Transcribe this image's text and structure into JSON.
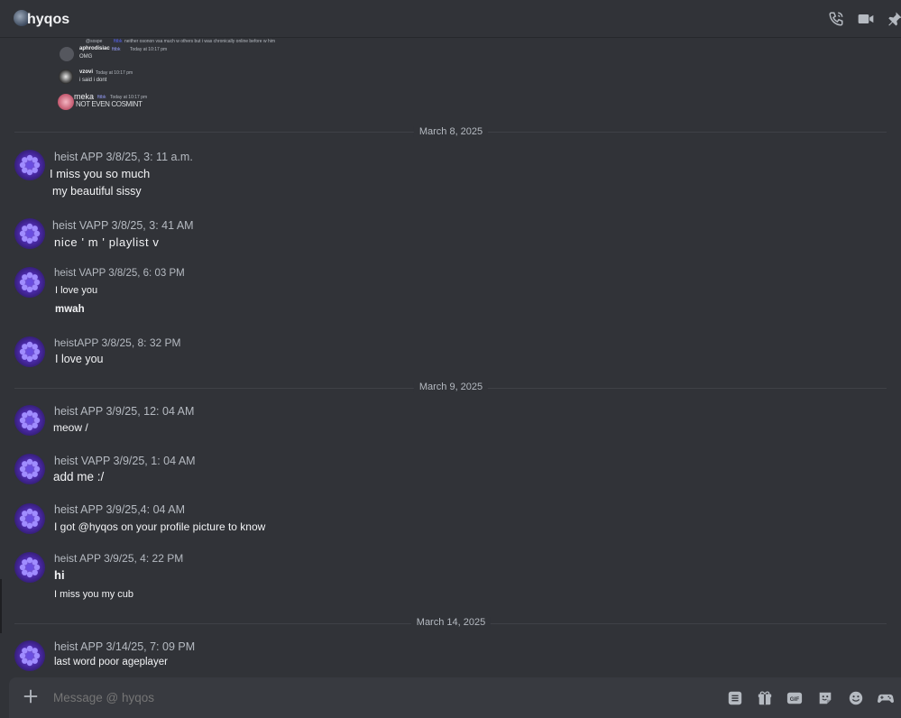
{
  "header": {
    "title": "hyqos"
  },
  "old_messages": [
    {
      "reply_user": "@sospe",
      "reply_tag": "fttbk",
      "reply_text": "neither osonon vsa much w others but i was chronically online before w him",
      "user": "aphrodisiac",
      "tag": "fttbk",
      "time": "Today at 10:17 pm",
      "text": "OMG"
    },
    {
      "user": "vzovi",
      "time": "Today at 10:17 pm",
      "text": "i said i dont"
    },
    {
      "user": "meka",
      "tag": "fttbk",
      "time": "Today at 10:17 pm",
      "text": "NOT EVEN COSMINT"
    }
  ],
  "dividers": {
    "d1": "March 8, 2025",
    "d2": "March 9, 2025",
    "d3": "March 14, 2025"
  },
  "messages": [
    {
      "meta": "heist APP 3/8/25, 3: 11 a.m.",
      "lines": [
        "I miss you so much",
        "my beautiful sissy"
      ]
    },
    {
      "meta": "heist VAPP 3/8/25, 3: 41 AM",
      "lines": [
        "nice ' m ' playlist v"
      ]
    },
    {
      "meta": "heist VAPP 3/8/25, 6: 03 PM",
      "lines": [
        "I love you",
        "mwah"
      ]
    },
    {
      "meta": "heistAPP 3/8/25, 8: 32 PM",
      "lines": [
        "I love you"
      ]
    },
    {
      "meta": "heist APP 3/9/25, 12: 04 AM",
      "lines": [
        "meow /"
      ]
    },
    {
      "meta": "heist VAPP 3/9/25, 1: 04 AM",
      "lines": [
        "add me :/"
      ]
    },
    {
      "meta": "heist APP 3/9/25,4: 04 AM",
      "lines": [
        "I got @hyqos on your profile picture to know"
      ]
    },
    {
      "meta": "heist APP 3/9/25, 4: 22 PM",
      "lines": [
        "hi",
        "I miss you my cub"
      ]
    },
    {
      "meta": "heist APP 3/14/25, 7: 09 PM",
      "lines": [
        "last word poor ageplayer"
      ]
    }
  ],
  "composer": {
    "placeholder": "Message @ hyqos"
  },
  "icons": {
    "call": "phone-icon",
    "video": "video-camera-icon",
    "pin": "pin-icon",
    "plus": "plus-icon",
    "apps": "apps-icon",
    "gift": "gift-icon",
    "gif": "gif-icon",
    "sticker": "sticker-icon",
    "emoji": "emoji-icon",
    "activities": "gamepad-icon"
  },
  "colors": {
    "background": "#313338",
    "composer": "#383a40",
    "avatar_purple": "#6b4bd6"
  }
}
